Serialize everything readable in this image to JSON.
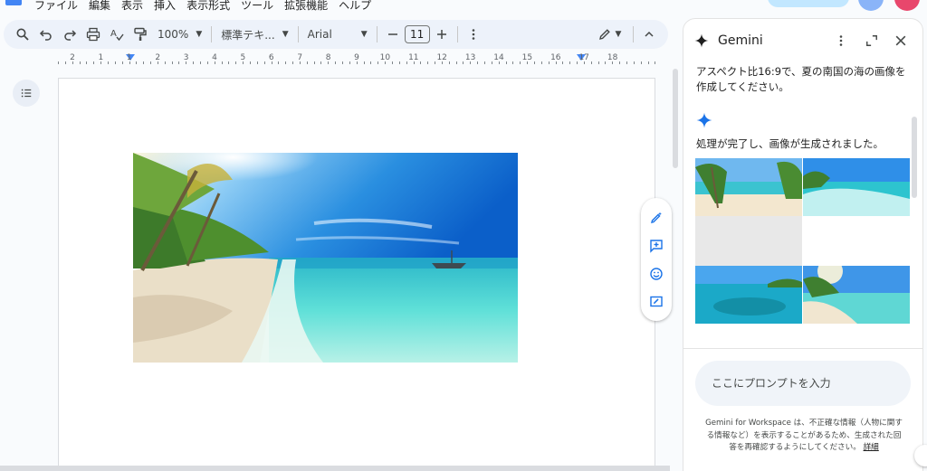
{
  "menubar": {
    "items": [
      "ファイル",
      "編集",
      "表示",
      "挿入",
      "表示形式",
      "ツール",
      "拡張機能",
      "ヘルプ"
    ]
  },
  "toolbar": {
    "zoom": "100%",
    "style": "標準テキ...",
    "font": "Arial",
    "font_size": "11"
  },
  "ruler": {
    "labels": [
      "2",
      "1",
      "1",
      "2",
      "3",
      "4",
      "5",
      "6",
      "7",
      "8",
      "9",
      "10",
      "11",
      "12",
      "13",
      "14",
      "15",
      "16",
      "17",
      "18"
    ]
  },
  "gemini": {
    "title": "Gemini",
    "user_prompt": "アスペクト比16:9で、夏の南国の海の画像を作成してください。",
    "response": "処理が完了し、画像が生成されました。",
    "input_placeholder": "ここにプロンプトを入力",
    "disclaimer": "Gemini for Workspace は、不正確な情報（人物に関する情報など）を表示することがあるため、生成された回答を再確認するようにしてください。",
    "details_link": "詳細"
  },
  "colors": {
    "accent": "#4285f4",
    "toolbar_bg": "#edf2fa",
    "gemini_input_bg": "#f0f4f9"
  }
}
